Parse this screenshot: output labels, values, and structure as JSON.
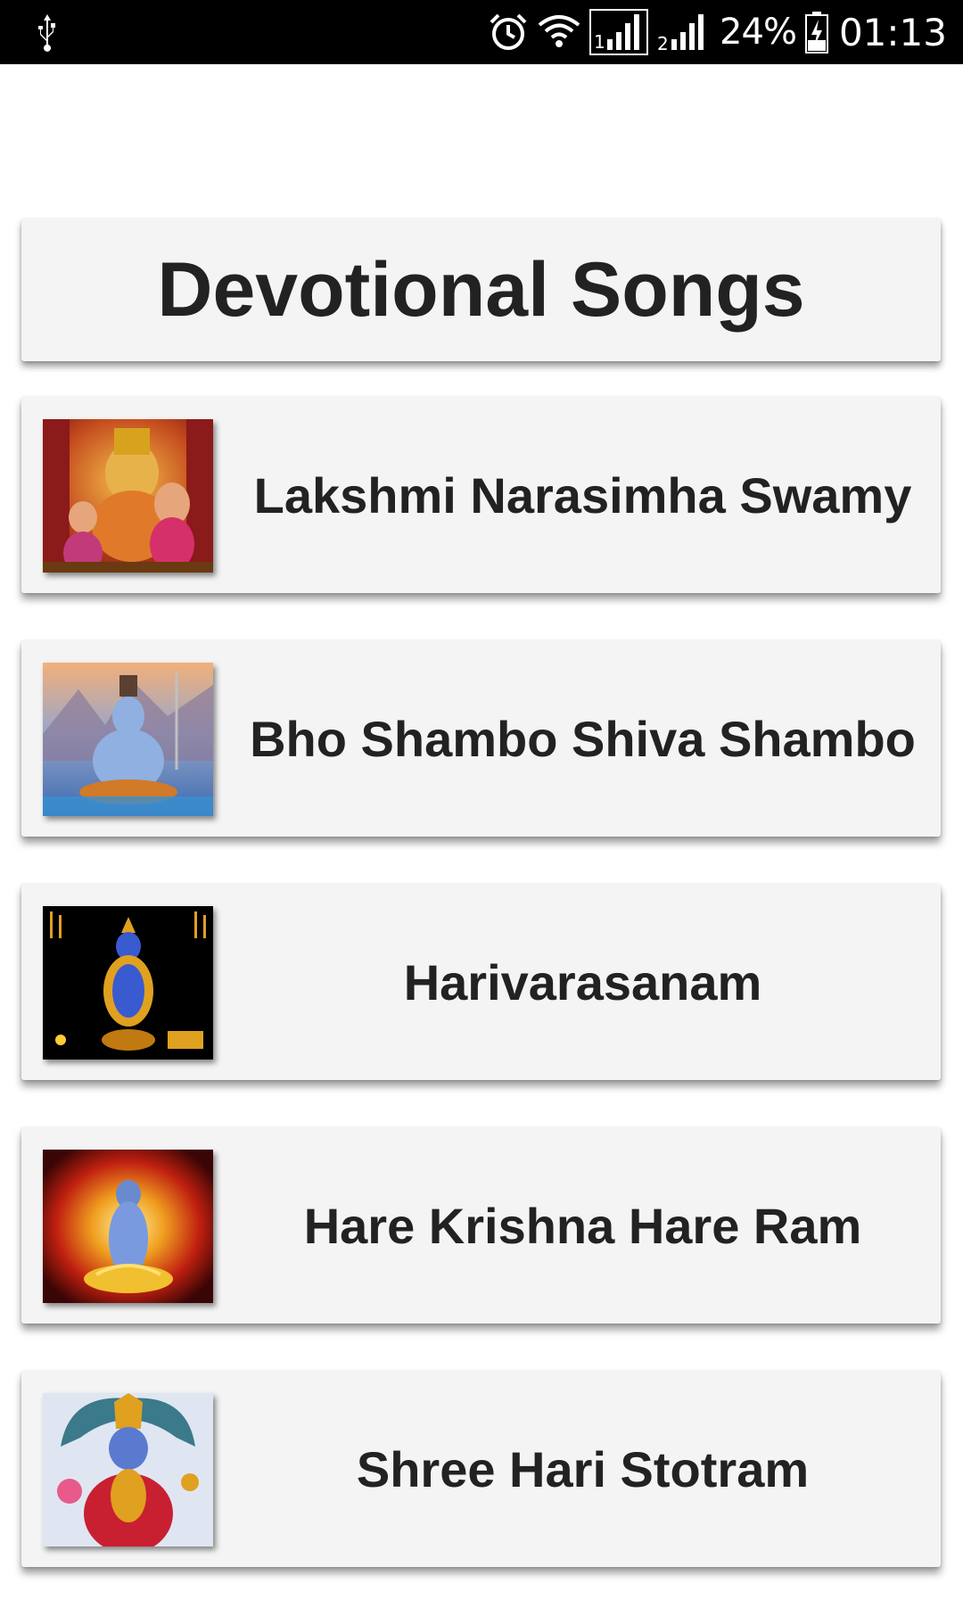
{
  "status_bar": {
    "battery_percent": "24%",
    "time": "01:13",
    "icons": [
      "usb-icon",
      "alarm-icon",
      "wifi-icon",
      "sim1-signal-icon",
      "sim2-signal-icon",
      "battery-charging-icon"
    ]
  },
  "header": {
    "title": "Devotional Songs"
  },
  "songs": [
    {
      "title": "Lakshmi Narasimha Swamy",
      "thumbnail": "lakshmi-narasimha-thumbnail"
    },
    {
      "title": "Bho Shambo Shiva Shambo",
      "thumbnail": "shiva-thumbnail"
    },
    {
      "title": "Harivarasanam",
      "thumbnail": "ayyappa-thumbnail"
    },
    {
      "title": "Hare Krishna Hare Ram",
      "thumbnail": "krishna-thumbnail"
    },
    {
      "title": "Shree Hari Stotram",
      "thumbnail": "vishnu-thumbnail"
    }
  ],
  "colors": {
    "status_bar_bg": "#000000",
    "card_bg": "#f4f4f4",
    "text": "#222222"
  }
}
